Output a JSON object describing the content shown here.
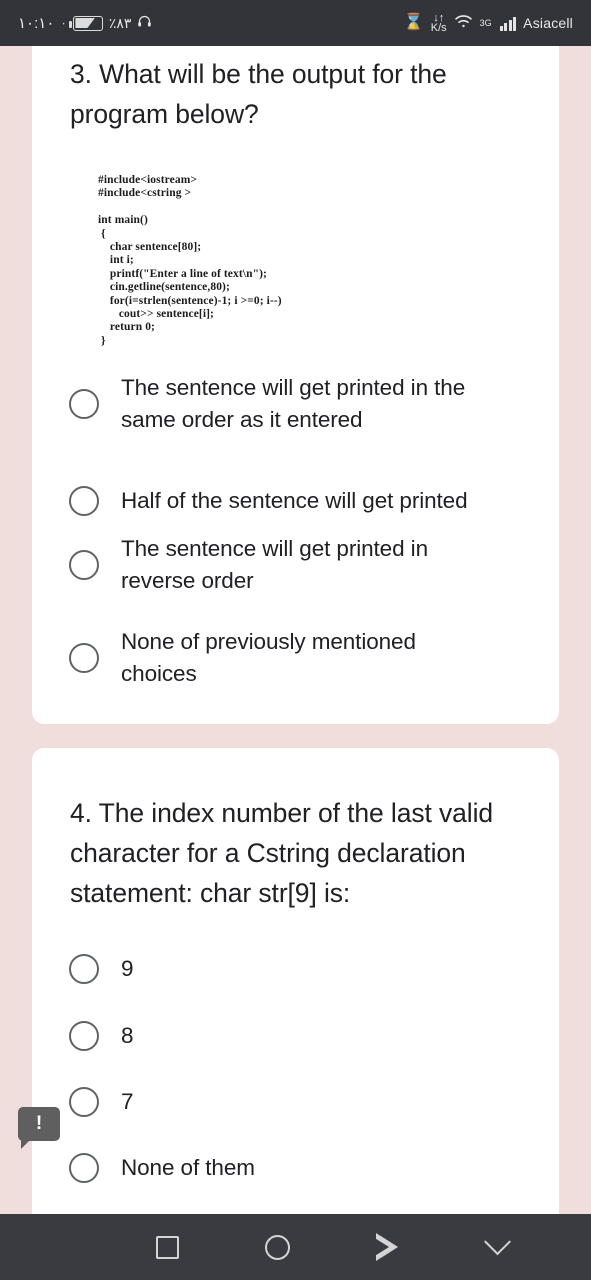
{
  "statusbar": {
    "time": "١٠:١٠",
    "separator": "٠",
    "battery_percent": "٪٨٣",
    "headphone_icon": "headphone-icon",
    "hourglass_icon": "hourglass-icon",
    "data_rate_arrow": "↓↑",
    "data_rate_unit": "K/s",
    "wifi_icon": "wifi-icon",
    "network_type": "3G",
    "carrier": "Asiacell"
  },
  "questions": [
    {
      "number": "3.",
      "title": "3. What will be the output for the program below?",
      "code": "#include<iostream>\n#include<cstring >\n\nint main()\n {\n    char sentence[80];\n    int i;\n    printf(\"Enter a line of text\\n\");\n    cin.getline(sentence,80);\n    for(i=strlen(sentence)-1; i >=0; i--)\n       cout>> sentence[i];\n    return 0;\n }",
      "options": [
        {
          "label": "The sentence will get printed in the same order as it entered",
          "selected": false
        },
        {
          "label": "Half of the sentence will get printed",
          "selected": false
        },
        {
          "label": "The sentence will get printed in reverse order",
          "selected": false
        },
        {
          "label": "None of previously mentioned choices",
          "selected": false
        }
      ]
    },
    {
      "number": "4.",
      "title": "4. The index number of the last valid character for a Cstring declaration statement: char str[9] is:",
      "options": [
        {
          "label": "9",
          "selected": false
        },
        {
          "label": "8",
          "selected": false
        },
        {
          "label": "7",
          "selected": false
        },
        {
          "label": "None of them",
          "selected": false
        }
      ]
    }
  ],
  "flag_badge": {
    "icon": "comment-alert-icon",
    "glyph": "!"
  },
  "navbar": {
    "recents": "recents-square-icon",
    "home": "home-circle-icon",
    "back": "back-triangle-icon",
    "hide_keyboard": "chevron-down-icon"
  },
  "colors": {
    "page_background": "#efdedc",
    "card_background": "#ffffff",
    "text_primary": "#202124",
    "radio_border": "#5f6368",
    "statusbar_background": "#33343a",
    "navbar_background": "#3a3b40"
  }
}
